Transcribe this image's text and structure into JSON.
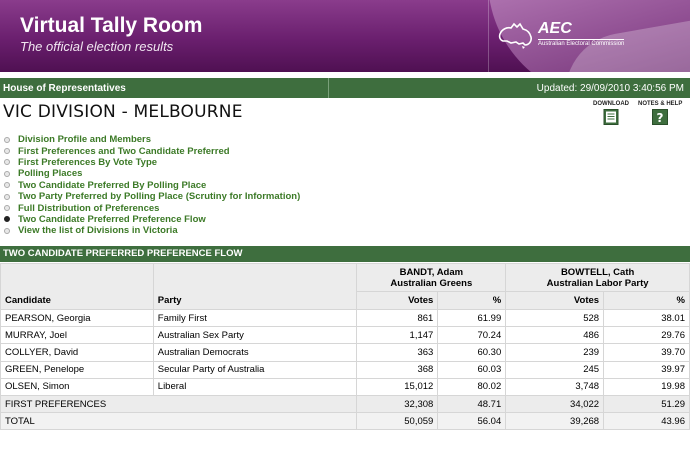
{
  "banner": {
    "title": "Virtual Tally Room",
    "subtitle": "The official election results",
    "org_abbr": "AEC",
    "org_full": "Australian Electoral Commission"
  },
  "house_bar": {
    "label": "House of Representatives",
    "updated": "Updated: 29/09/2010 3:40:56 PM"
  },
  "page_title": "VIC DIVISION - MELBOURNE",
  "tools": {
    "download_label": "DOWNLOAD",
    "help_label": "NOTES & HELP"
  },
  "nav_links": [
    {
      "label": "Division Profile and Members",
      "active": false
    },
    {
      "label": "First Preferences and Two Candidate Preferred",
      "active": false
    },
    {
      "label": "First Preferences By Vote Type",
      "active": false
    },
    {
      "label": "Polling Places",
      "active": false
    },
    {
      "label": "Two Candidate Preferred By Polling Place",
      "active": false
    },
    {
      "label": "Two Party Preferred by Polling Place (Scrutiny for Information)",
      "active": false
    },
    {
      "label": "Full Distribution of Preferences",
      "active": false
    },
    {
      "label": "Two Candidate Preferred Preference Flow",
      "active": true
    },
    {
      "label": "View the list of Divisions in Victoria",
      "active": false
    }
  ],
  "section_title": "TWO CANDIDATE PREFERRED PREFERENCE FLOW",
  "table": {
    "col_candidate": "Candidate",
    "col_party": "Party",
    "candidate_a": {
      "name": "BANDT, Adam",
      "party": "Australian Greens"
    },
    "candidate_b": {
      "name": "BOWTELL, Cath",
      "party": "Australian Labor Party"
    },
    "votes_label": "Votes",
    "pct_label": "%",
    "rows": [
      {
        "candidate": "PEARSON, Georgia",
        "party": "Family First",
        "a_votes": "861",
        "a_pct": "61.99",
        "b_votes": "528",
        "b_pct": "38.01"
      },
      {
        "candidate": "MURRAY, Joel",
        "party": "Australian Sex Party",
        "a_votes": "1,147",
        "a_pct": "70.24",
        "b_votes": "486",
        "b_pct": "29.76"
      },
      {
        "candidate": "COLLYER, David",
        "party": "Australian Democrats",
        "a_votes": "363",
        "a_pct": "60.30",
        "b_votes": "239",
        "b_pct": "39.70"
      },
      {
        "candidate": "GREEN, Penelope",
        "party": "Secular Party of Australia",
        "a_votes": "368",
        "a_pct": "60.03",
        "b_votes": "245",
        "b_pct": "39.97"
      },
      {
        "candidate": "OLSEN, Simon",
        "party": "Liberal",
        "a_votes": "15,012",
        "a_pct": "80.02",
        "b_votes": "3,748",
        "b_pct": "19.98"
      }
    ],
    "first_pref": {
      "label": "FIRST PREFERENCES",
      "a_votes": "32,308",
      "a_pct": "48.71",
      "b_votes": "34,022",
      "b_pct": "51.29"
    },
    "total": {
      "label": "TOTAL",
      "a_votes": "50,059",
      "a_pct": "56.04",
      "b_votes": "39,268",
      "b_pct": "43.96"
    }
  },
  "colors": {
    "banner_purple": "#6a1f6e",
    "bar_green": "#3e6e3e",
    "link_green": "#3c7a27"
  }
}
